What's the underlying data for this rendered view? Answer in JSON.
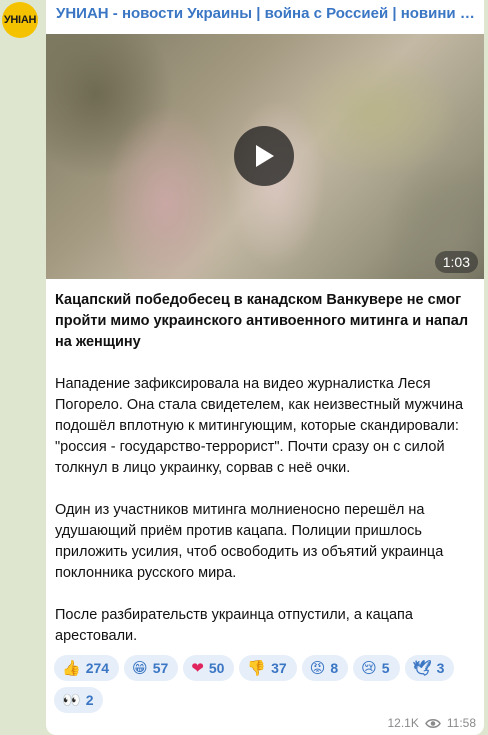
{
  "channel": {
    "avatar_text": "УНIАН",
    "title": "УНИАН - новости Украины | война с Россией | новини України | Україна"
  },
  "video": {
    "duration": "1:03"
  },
  "post": {
    "headline": "Кацапский победобесец в канадском Ванкувере не смог пройти мимо украинского антивоенного митинга и напал на женщину",
    "paragraphs": [
      "Нападение зафиксировала на видео журналистка Леся Погорело. Она стала свидетелем, как неизвестный мужчина подошёл вплотную к митингующим, которые скандировали: \"россия - государство-террорист\". Почти сразу он с силой толкнул в лицо украинку, сорвав с неё очки.",
      "Один из участников митинга молниеносно перешёл на удушающий приём против кацапа. Полиции пришлось приложить усилия, чтоб освободить из объятий украинца поклонника русского мира.",
      "После разбирательств украинца отпустили, а кацапа арестовали."
    ]
  },
  "reactions": [
    {
      "emoji": "👍",
      "icon": "thumbs-up-icon",
      "count": "274"
    },
    {
      "emoji": "😁",
      "icon": "grin-icon",
      "count": "57"
    },
    {
      "emoji": "❤",
      "icon": "heart-icon",
      "count": "50"
    },
    {
      "emoji": "👎",
      "icon": "thumbs-down-icon",
      "count": "37"
    },
    {
      "emoji": "😡",
      "icon": "angry-face-icon",
      "count": "8"
    },
    {
      "emoji": "😢",
      "icon": "crying-face-icon",
      "count": "5"
    },
    {
      "emoji": "🕊",
      "icon": "dove-icon",
      "count": "3"
    },
    {
      "emoji": "👀",
      "icon": "eyes-icon",
      "count": "2"
    }
  ],
  "footer": {
    "views": "12.1K",
    "time": "11:58"
  },
  "colors": {
    "accent": "#3a76c4",
    "background": "#dfe6cf",
    "reaction_bg": "#e6eef9",
    "avatar": "#f5c200"
  }
}
